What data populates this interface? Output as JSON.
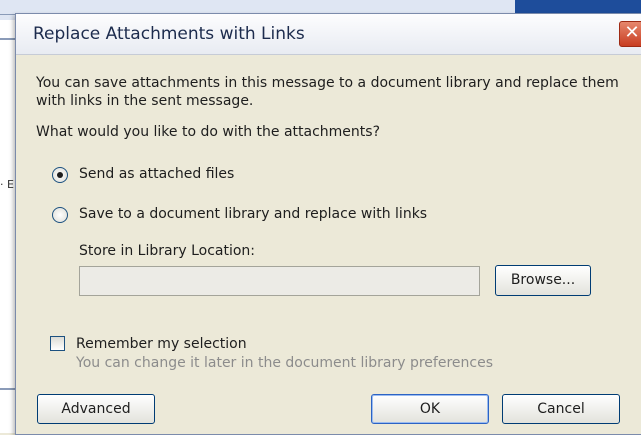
{
  "background": {
    "left_edge_text": "· Er"
  },
  "dialog": {
    "title": "Replace Attachments with Links",
    "close_label": "✕",
    "intro_text": "You can save attachments in this message to a document library and replace them with links in the sent message.",
    "question": "What would you like to do with the attachments?",
    "options": [
      {
        "label": "Send as attached files",
        "checked": true
      },
      {
        "label": "Save to a document library and replace with links",
        "checked": false
      }
    ],
    "store_label": "Store in Library Location:",
    "location_value": "",
    "browse_label": "Browse...",
    "remember_label": "Remember my selection",
    "remember_checked": false,
    "remember_hint": "You can change it later in the document library preferences",
    "advanced_label": "Advanced",
    "ok_label": "OK",
    "cancel_label": "Cancel"
  },
  "colors": {
    "title_text": "#1c2b4d",
    "close_button": "#c83d21",
    "dialog_bg": "#ece9d8",
    "hint_text": "#8c8c8c"
  }
}
